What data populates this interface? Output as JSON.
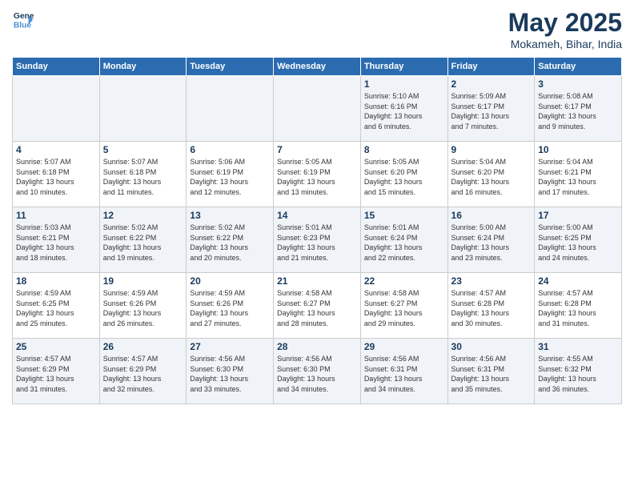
{
  "header": {
    "logo_line1": "General",
    "logo_line2": "Blue",
    "month": "May 2025",
    "location": "Mokameh, Bihar, India"
  },
  "days_of_week": [
    "Sunday",
    "Monday",
    "Tuesday",
    "Wednesday",
    "Thursday",
    "Friday",
    "Saturday"
  ],
  "weeks": [
    [
      {
        "day": "",
        "info": ""
      },
      {
        "day": "",
        "info": ""
      },
      {
        "day": "",
        "info": ""
      },
      {
        "day": "",
        "info": ""
      },
      {
        "day": "1",
        "info": "Sunrise: 5:10 AM\nSunset: 6:16 PM\nDaylight: 13 hours\nand 6 minutes."
      },
      {
        "day": "2",
        "info": "Sunrise: 5:09 AM\nSunset: 6:17 PM\nDaylight: 13 hours\nand 7 minutes."
      },
      {
        "day": "3",
        "info": "Sunrise: 5:08 AM\nSunset: 6:17 PM\nDaylight: 13 hours\nand 9 minutes."
      }
    ],
    [
      {
        "day": "4",
        "info": "Sunrise: 5:07 AM\nSunset: 6:18 PM\nDaylight: 13 hours\nand 10 minutes."
      },
      {
        "day": "5",
        "info": "Sunrise: 5:07 AM\nSunset: 6:18 PM\nDaylight: 13 hours\nand 11 minutes."
      },
      {
        "day": "6",
        "info": "Sunrise: 5:06 AM\nSunset: 6:19 PM\nDaylight: 13 hours\nand 12 minutes."
      },
      {
        "day": "7",
        "info": "Sunrise: 5:05 AM\nSunset: 6:19 PM\nDaylight: 13 hours\nand 13 minutes."
      },
      {
        "day": "8",
        "info": "Sunrise: 5:05 AM\nSunset: 6:20 PM\nDaylight: 13 hours\nand 15 minutes."
      },
      {
        "day": "9",
        "info": "Sunrise: 5:04 AM\nSunset: 6:20 PM\nDaylight: 13 hours\nand 16 minutes."
      },
      {
        "day": "10",
        "info": "Sunrise: 5:04 AM\nSunset: 6:21 PM\nDaylight: 13 hours\nand 17 minutes."
      }
    ],
    [
      {
        "day": "11",
        "info": "Sunrise: 5:03 AM\nSunset: 6:21 PM\nDaylight: 13 hours\nand 18 minutes."
      },
      {
        "day": "12",
        "info": "Sunrise: 5:02 AM\nSunset: 6:22 PM\nDaylight: 13 hours\nand 19 minutes."
      },
      {
        "day": "13",
        "info": "Sunrise: 5:02 AM\nSunset: 6:22 PM\nDaylight: 13 hours\nand 20 minutes."
      },
      {
        "day": "14",
        "info": "Sunrise: 5:01 AM\nSunset: 6:23 PM\nDaylight: 13 hours\nand 21 minutes."
      },
      {
        "day": "15",
        "info": "Sunrise: 5:01 AM\nSunset: 6:24 PM\nDaylight: 13 hours\nand 22 minutes."
      },
      {
        "day": "16",
        "info": "Sunrise: 5:00 AM\nSunset: 6:24 PM\nDaylight: 13 hours\nand 23 minutes."
      },
      {
        "day": "17",
        "info": "Sunrise: 5:00 AM\nSunset: 6:25 PM\nDaylight: 13 hours\nand 24 minutes."
      }
    ],
    [
      {
        "day": "18",
        "info": "Sunrise: 4:59 AM\nSunset: 6:25 PM\nDaylight: 13 hours\nand 25 minutes."
      },
      {
        "day": "19",
        "info": "Sunrise: 4:59 AM\nSunset: 6:26 PM\nDaylight: 13 hours\nand 26 minutes."
      },
      {
        "day": "20",
        "info": "Sunrise: 4:59 AM\nSunset: 6:26 PM\nDaylight: 13 hours\nand 27 minutes."
      },
      {
        "day": "21",
        "info": "Sunrise: 4:58 AM\nSunset: 6:27 PM\nDaylight: 13 hours\nand 28 minutes."
      },
      {
        "day": "22",
        "info": "Sunrise: 4:58 AM\nSunset: 6:27 PM\nDaylight: 13 hours\nand 29 minutes."
      },
      {
        "day": "23",
        "info": "Sunrise: 4:57 AM\nSunset: 6:28 PM\nDaylight: 13 hours\nand 30 minutes."
      },
      {
        "day": "24",
        "info": "Sunrise: 4:57 AM\nSunset: 6:28 PM\nDaylight: 13 hours\nand 31 minutes."
      }
    ],
    [
      {
        "day": "25",
        "info": "Sunrise: 4:57 AM\nSunset: 6:29 PM\nDaylight: 13 hours\nand 31 minutes."
      },
      {
        "day": "26",
        "info": "Sunrise: 4:57 AM\nSunset: 6:29 PM\nDaylight: 13 hours\nand 32 minutes."
      },
      {
        "day": "27",
        "info": "Sunrise: 4:56 AM\nSunset: 6:30 PM\nDaylight: 13 hours\nand 33 minutes."
      },
      {
        "day": "28",
        "info": "Sunrise: 4:56 AM\nSunset: 6:30 PM\nDaylight: 13 hours\nand 34 minutes."
      },
      {
        "day": "29",
        "info": "Sunrise: 4:56 AM\nSunset: 6:31 PM\nDaylight: 13 hours\nand 34 minutes."
      },
      {
        "day": "30",
        "info": "Sunrise: 4:56 AM\nSunset: 6:31 PM\nDaylight: 13 hours\nand 35 minutes."
      },
      {
        "day": "31",
        "info": "Sunrise: 4:55 AM\nSunset: 6:32 PM\nDaylight: 13 hours\nand 36 minutes."
      }
    ]
  ]
}
